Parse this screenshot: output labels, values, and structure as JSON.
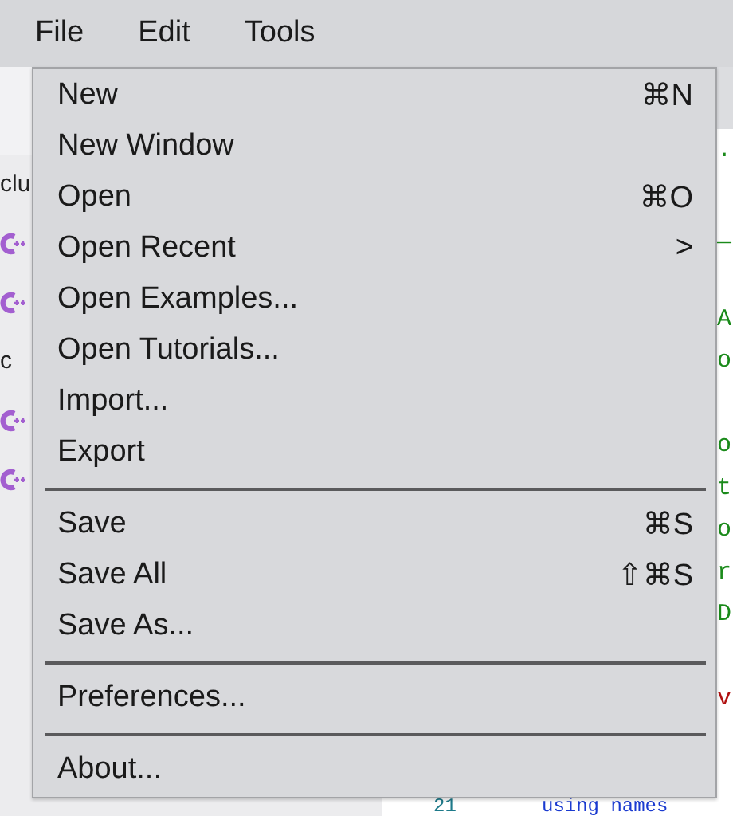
{
  "menu_bar": [
    {
      "label": "File"
    },
    {
      "label": "Edit"
    },
    {
      "label": "Tools"
    }
  ],
  "sidebar": {
    "items": [
      {
        "kind": "folder",
        "text": "clu"
      },
      {
        "kind": "file"
      },
      {
        "kind": "file"
      },
      {
        "kind": "folder",
        "text": "c"
      },
      {
        "kind": "file"
      },
      {
        "kind": "file"
      }
    ]
  },
  "editor": {
    "fragments": [
      {
        "text": ".",
        "color": "#1a8a1a"
      },
      {
        "text": "_",
        "color": "#1a8a1a"
      },
      {
        "text": "A",
        "color": "#1a8a1a"
      },
      {
        "text": "o",
        "color": "#1a8a1a"
      },
      {
        "text": "o",
        "color": "#1a8a1a"
      },
      {
        "text": "t",
        "color": "#1a8a1a"
      },
      {
        "text": "o",
        "color": "#1a8a1a"
      },
      {
        "text": "r",
        "color": "#1a8a1a"
      },
      {
        "text": "D",
        "color": "#1a8a1a"
      },
      {
        "text": "v",
        "color": "#b01010"
      }
    ],
    "last_line": {
      "number": "21",
      "text": "using names"
    }
  },
  "file_menu": {
    "items": [
      {
        "kind": "item",
        "label": "New",
        "shortcut": "⌘N"
      },
      {
        "kind": "item",
        "label": "New Window"
      },
      {
        "kind": "item",
        "label": "Open",
        "shortcut": "⌘O"
      },
      {
        "kind": "submenu",
        "label": "Open Recent",
        "arrow": ">"
      },
      {
        "kind": "item",
        "label": "Open Examples..."
      },
      {
        "kind": "item",
        "label": "Open Tutorials..."
      },
      {
        "kind": "item",
        "label": "Import..."
      },
      {
        "kind": "item",
        "label": "Export"
      },
      {
        "kind": "separator"
      },
      {
        "kind": "item",
        "label": "Save",
        "shortcut": "⌘S"
      },
      {
        "kind": "item",
        "label": "Save All",
        "shortcut": "⇧⌘S"
      },
      {
        "kind": "item",
        "label": "Save As..."
      },
      {
        "kind": "separator"
      },
      {
        "kind": "item",
        "label": "Preferences..."
      },
      {
        "kind": "separator"
      },
      {
        "kind": "item",
        "label": "About..."
      }
    ]
  }
}
